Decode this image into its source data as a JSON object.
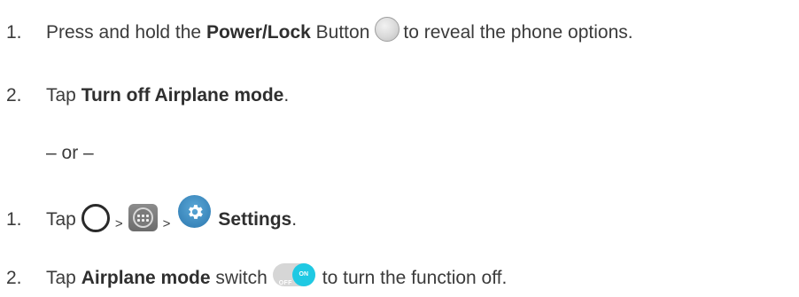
{
  "steps_a": [
    {
      "number": "1.",
      "pre": "Press and hold the ",
      "bold": "Power/Lock",
      "mid": " Button",
      "post": "to reveal the phone options."
    },
    {
      "number": "2.",
      "pre": "Tap ",
      "bold": "Turn off Airplane mode",
      "post": "."
    }
  ],
  "separator": "– or –",
  "steps_b": [
    {
      "number": "1.",
      "pre": "Tap",
      "sep1": ">",
      "sep2": ">",
      "bold": "Settings",
      "post": "."
    },
    {
      "number": "2.",
      "pre": "Tap ",
      "bold": "Airplane mode",
      "mid": " switch",
      "switch_off_label": "OFF",
      "switch_on_label": "ON",
      "post": "to turn the function off."
    }
  ],
  "icons": {
    "power": "power-button-icon",
    "home": "home-icon",
    "apps": "apps-icon",
    "settings": "settings-gear-icon",
    "switch": "toggle-switch-icon"
  },
  "colors": {
    "settings_blue": "#3a86bb",
    "switch_on": "#1fc9e3",
    "text": "#3b3b3b"
  }
}
